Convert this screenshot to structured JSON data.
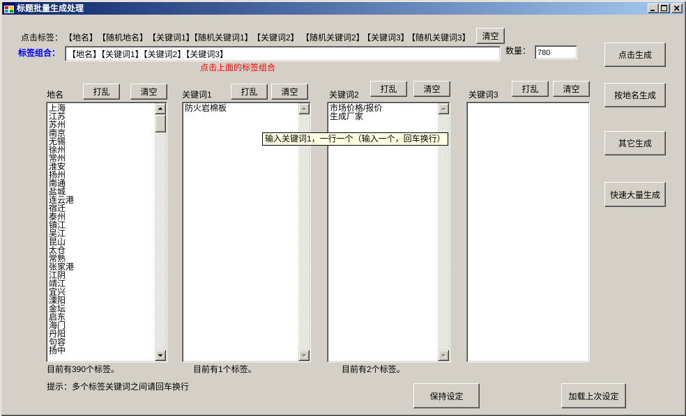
{
  "window": {
    "title": "标题批量生成处理"
  },
  "colors": {
    "face": "#d4d0c8",
    "title_start": "#0a246a",
    "title_end": "#a6caf0",
    "label_blue": "#0000ff",
    "hint_red": "#ff0000",
    "tooltip_bg": "#ffffe1"
  },
  "icons": {
    "app": "app-icon",
    "minimize": "minimize-icon",
    "maximize": "maximize-icon",
    "close": "close-icon",
    "scroll_up": "scroll-up-arrow-icon",
    "scroll_down": "scroll-down-arrow-icon"
  },
  "tag_bar": {
    "label": "点击标签：",
    "tags": [
      "【地名】",
      "【随机地名】",
      "【关键词1】",
      "【随机关键词1】",
      "【关键词2】",
      "【随机关键词2】",
      "【关键词3】",
      "【随机关键词3】"
    ],
    "clear_label": "清空"
  },
  "combo": {
    "label": "标签组合：",
    "value": "【地名】【关键词1】【关键词2】【关键词3】",
    "hint": "点击上面的标签组合"
  },
  "quantity": {
    "label": "数量：",
    "value": "780"
  },
  "actions": {
    "generate": "点击生成",
    "by_place": "按地名生成",
    "other": "其它生成",
    "bulk": "快速大量生成"
  },
  "columns": [
    {
      "label": "地名",
      "shuffle_label": "打乱",
      "clear_label": "清空",
      "items": [
        "上海",
        "江苏",
        "苏州",
        "南京",
        "无锡",
        "徐州",
        "常州",
        "淮安",
        "扬州",
        "南通",
        "盐城",
        "连云港",
        "宿迁",
        "泰州",
        "镇江",
        "吴江",
        "昆山",
        "太仓",
        "常熟",
        "张家港",
        "江阴",
        "靖江",
        "宜兴",
        "溧阳",
        "金坛",
        "启东",
        "海门",
        "丹阳",
        "句容",
        "扬中"
      ],
      "status": "目前有390个标签。",
      "scrollbar": {
        "visible": true,
        "enabled": true,
        "scroll_position": 0,
        "visible_fraction": 0.077
      }
    },
    {
      "label": "关键词1",
      "shuffle_label": "打乱",
      "clear_label": "清空",
      "items": [
        "防火岩棉板"
      ],
      "status": "目前有1个标签。",
      "scrollbar": {
        "visible": true,
        "enabled": false
      }
    },
    {
      "label": "关键词2",
      "shuffle_label": "打乱",
      "clear_label": "清空",
      "items": [
        "市场价格/报价",
        "生成厂家"
      ],
      "status": "目前有2个标签。",
      "scrollbar": {
        "visible": true,
        "enabled": false
      }
    },
    {
      "label": "关键词3",
      "shuffle_label": "打乱",
      "clear_label": "清空",
      "items": [],
      "scrollbar": {
        "visible": false
      }
    }
  ],
  "tooltip": "输入关键词1，一行一个（输入一个，回车换行）",
  "tip": "提示：多个标签关键词之间请回车换行",
  "footer": {
    "save_label": "保持设定",
    "load_label": "加载上次设定"
  }
}
